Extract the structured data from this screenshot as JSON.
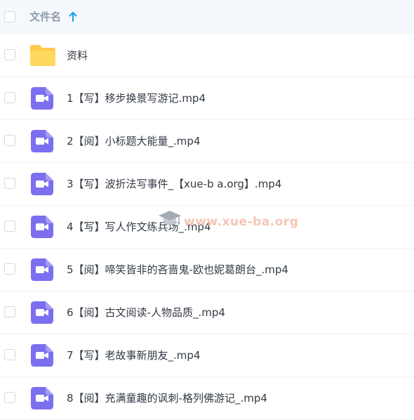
{
  "header": {
    "column_label": "文件名",
    "sort_icon": "arrow-up-icon"
  },
  "folder": {
    "name": "资料",
    "icon": "folder-icon",
    "color": "#ffd25a"
  },
  "files": [
    {
      "name": "1【写】移步换景写游记.mp4"
    },
    {
      "name": "2【阅】小标题大能量_.mp4"
    },
    {
      "name": "3【写】波折法写事件_【xue-b a.org】.mp4"
    },
    {
      "name": "4【写】写人作文练兵场_.mp4"
    },
    {
      "name": "5【阅】啼笑皆非的吝啬鬼-欧也妮葛朗台_.mp4"
    },
    {
      "name": "6【阅】古文阅读-人物品质_.mp4"
    },
    {
      "name": "7【写】老故事新朋友_.mp4"
    },
    {
      "name": "8【阅】充满童趣的讽刺-格列佛游记_.mp4"
    }
  ],
  "video_icon": {
    "icon": "video-file-icon",
    "color": "#7b6ff0"
  },
  "watermark": {
    "text": "www.xue-ba.org",
    "icon": "graduation-cap-icon"
  },
  "colors": {
    "accent": "#1a9bf0",
    "header_bg": "#f5f8fd"
  }
}
